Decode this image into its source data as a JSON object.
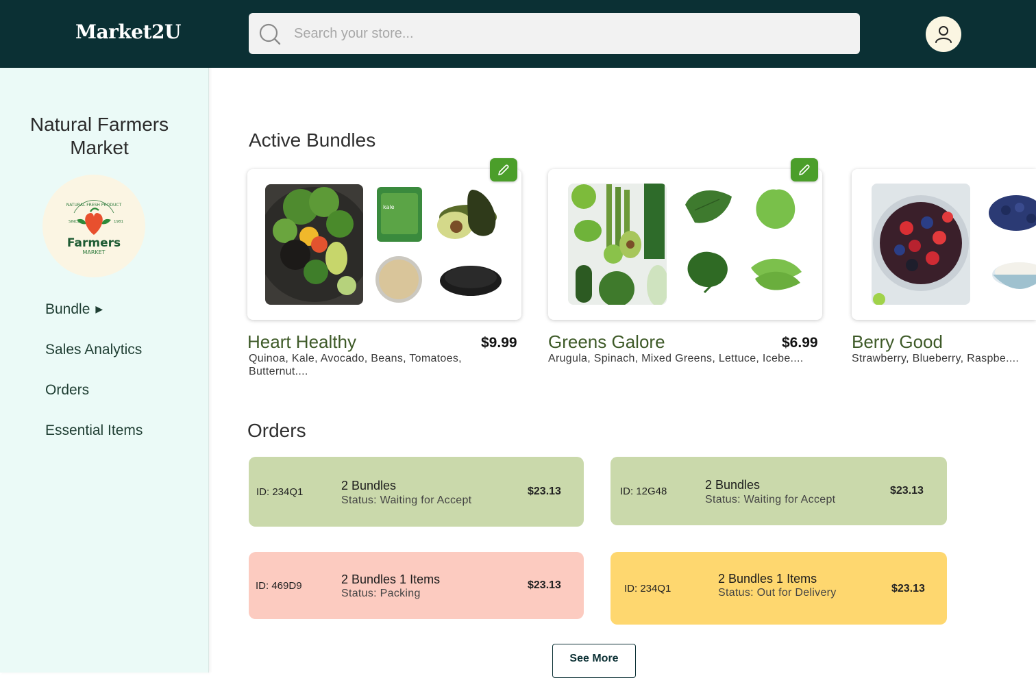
{
  "header": {
    "logo": "Market2U",
    "search_placeholder": "Search your store..."
  },
  "sidebar": {
    "store_name": "Natural Farmers Market",
    "store_logo": {
      "top_text": "NATURAL FRESH PRODUCT",
      "since": "SINCE",
      "year": "1981",
      "brand": "Farmers",
      "sub": "MARKET"
    },
    "items": [
      {
        "label": "Bundle",
        "arrow": "▶"
      },
      {
        "label": "Sales Analytics"
      },
      {
        "label": "Orders"
      },
      {
        "label": "Essential Items"
      }
    ]
  },
  "bundles": {
    "title": "Active Bundles",
    "items": [
      {
        "name": "Heart Healthy",
        "price": "$9.99",
        "description": "Quinoa, Kale, Avocado, Beans, Tomatoes, Butternut...."
      },
      {
        "name": "Greens Galore",
        "price": "$6.99",
        "description": "Arugula, Spinach, Mixed Greens, Lettuce, Icebe...."
      },
      {
        "name": "Berry Good",
        "price": "",
        "description": "Strawberry, Blueberry, Raspbe...."
      }
    ],
    "kale_pack_label": "kale"
  },
  "orders": {
    "title": "Orders",
    "items": [
      {
        "id": "ID: 234Q1",
        "title": "2 Bundles",
        "status": "Status: Waiting for Accept",
        "price": "$23.13",
        "color": "#cad9ab"
      },
      {
        "id": "ID: 12G48",
        "title": "2 Bundles",
        "status": "Status: Waiting for Accept",
        "price": "$23.13",
        "color": "#cad9ab"
      },
      {
        "id": "ID: 469D9",
        "title": "2 Bundles 1 Items",
        "status": "Status: Packing",
        "price": "$23.13",
        "color": "#fccbc0"
      },
      {
        "id": "ID: 234Q1",
        "title": "2 Bundles 1 Items",
        "status": "Status: Out for Delivery",
        "price": "$23.13",
        "color": "#fed76f"
      }
    ],
    "see_more": "See More"
  },
  "colors": {
    "header_bg": "#0b3034",
    "sidebar_bg": "#ebfaf7",
    "accent_green": "#4b9e2a",
    "bundle_name": "#3e5a28"
  },
  "icons": [
    "search-icon",
    "user-icon",
    "pencil-icon",
    "triangle-right-icon"
  ]
}
